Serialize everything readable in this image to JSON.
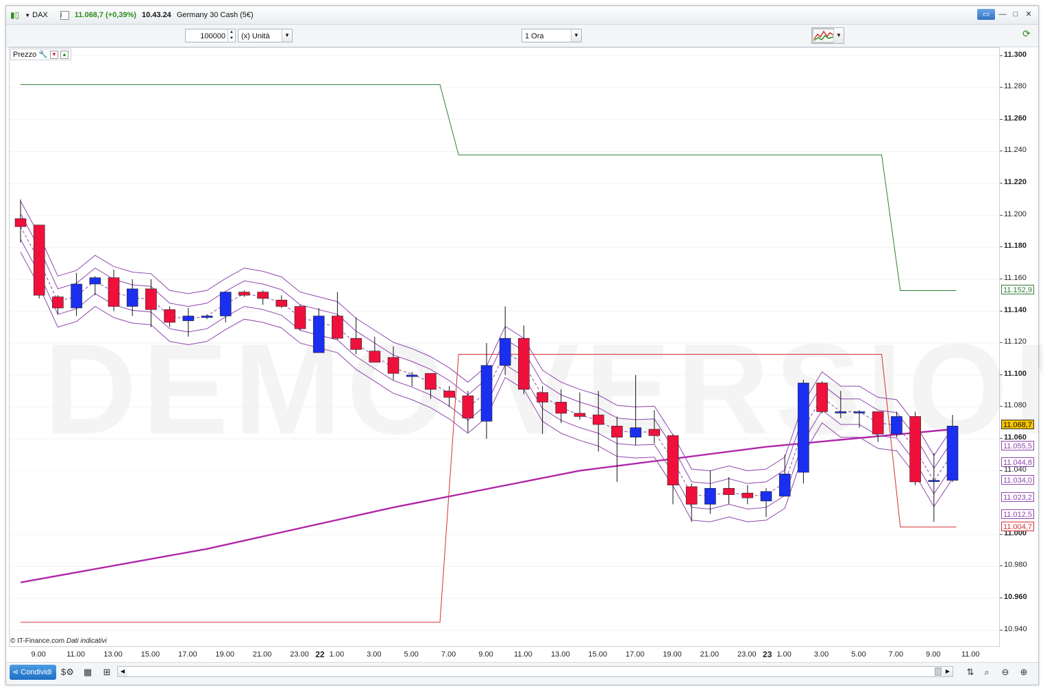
{
  "titlebar": {
    "symbol": "DAX",
    "info_icon": "i",
    "price_change": "11.068,7 (+0,39%)",
    "time": "10.43.24",
    "instrument": "Germany 30 Cash (5€)",
    "window_buttons": [
      "▭",
      "—",
      "□",
      "✕"
    ]
  },
  "toolbar": {
    "quantity": "100000",
    "unit": "(x) Unità",
    "timeframe": "1 Ora"
  },
  "chart": {
    "panel_label": "Prezzo",
    "watermark": "DEMO VERSION",
    "source_note": "© IT-Finance.com",
    "source_note_italic": "Dati indicativi",
    "price_ticks": [
      "11.300",
      "11.280",
      "11.260",
      "11.240",
      "11.220",
      "11.200",
      "11.180",
      "11.160",
      "11.140",
      "11.120",
      "11.100",
      "11.080",
      "11.060",
      "11.040",
      "11.000",
      "10.980",
      "10.960",
      "10.940"
    ],
    "price_tags": [
      {
        "label": "11.152,9",
        "kind": "green"
      },
      {
        "label": "11.068,7",
        "kind": "current"
      },
      {
        "label": "11.055,5",
        "kind": "purple"
      },
      {
        "label": "11.044,8",
        "kind": "purple"
      },
      {
        "label": "11.034,0",
        "kind": "purple"
      },
      {
        "label": "11.023,2",
        "kind": "purple"
      },
      {
        "label": "11.012,5",
        "kind": "purple"
      },
      {
        "label": "11.004,7",
        "kind": "red"
      }
    ],
    "time_labels": [
      {
        "t": "9.00",
        "day": false
      },
      {
        "t": "11.00",
        "day": false
      },
      {
        "t": "13.00",
        "day": false
      },
      {
        "t": "15.00",
        "day": false
      },
      {
        "t": "17.00",
        "day": false
      },
      {
        "t": "19.00",
        "day": false
      },
      {
        "t": "21.00",
        "day": false
      },
      {
        "t": "23.00",
        "day": false
      },
      {
        "t": "22",
        "day": true
      },
      {
        "t": "1.00",
        "day": false
      },
      {
        "t": "3.00",
        "day": false
      },
      {
        "t": "5.00",
        "day": false
      },
      {
        "t": "7.00",
        "day": false
      },
      {
        "t": "9.00",
        "day": false
      },
      {
        "t": "11.00",
        "day": false
      },
      {
        "t": "13.00",
        "day": false
      },
      {
        "t": "15.00",
        "day": false
      },
      {
        "t": "17.00",
        "day": false
      },
      {
        "t": "19.00",
        "day": false
      },
      {
        "t": "21.00",
        "day": false
      },
      {
        "t": "23.00",
        "day": false
      },
      {
        "t": "23",
        "day": true
      },
      {
        "t": "1.00",
        "day": false
      },
      {
        "t": "3.00",
        "day": false
      },
      {
        "t": "5.00",
        "day": false
      },
      {
        "t": "7.00",
        "day": false
      },
      {
        "t": "9.00",
        "day": false
      },
      {
        "t": "11.00",
        "day": false
      }
    ],
    "colors": {
      "up": "#1a2ff0",
      "down": "#f0103c",
      "resistance": "#2e7d32",
      "support": "#d32f2f",
      "bands": "#8e44ad",
      "ma": "#b026a8",
      "current": "#f5c400"
    }
  },
  "chart_data": {
    "type": "candlestick",
    "candles": [
      {
        "o": 11198,
        "h": 11210,
        "l": 11183,
        "c": 11193
      },
      {
        "o": 11194,
        "h": 11194,
        "l": 11148,
        "c": 11150
      },
      {
        "o": 11149,
        "h": 11150,
        "l": 11138,
        "c": 11142
      },
      {
        "o": 11142,
        "h": 11164,
        "l": 11137,
        "c": 11157
      },
      {
        "o": 11157,
        "h": 11162,
        "l": 11150,
        "c": 11161
      },
      {
        "o": 11161,
        "h": 11166,
        "l": 11140,
        "c": 11143
      },
      {
        "o": 11143,
        "h": 11160,
        "l": 11137,
        "c": 11154
      },
      {
        "o": 11154,
        "h": 11160,
        "l": 11130,
        "c": 11141
      },
      {
        "o": 11141,
        "h": 11143,
        "l": 11130,
        "c": 11133
      },
      {
        "o": 11134,
        "h": 11142,
        "l": 11124,
        "c": 11137
      },
      {
        "o": 11136,
        "h": 11138,
        "l": 11135,
        "c": 11137
      },
      {
        "o": 11137,
        "h": 11152,
        "l": 11133,
        "c": 11152
      },
      {
        "o": 11152,
        "h": 11153,
        "l": 11149,
        "c": 11150
      },
      {
        "o": 11152,
        "h": 11153,
        "l": 11144,
        "c": 11148
      },
      {
        "o": 11147,
        "h": 11150,
        "l": 11142,
        "c": 11143
      },
      {
        "o": 11143,
        "h": 11144,
        "l": 11128,
        "c": 11129
      },
      {
        "o": 11114,
        "h": 11142,
        "l": 11114,
        "c": 11137
      },
      {
        "o": 11137,
        "h": 11152,
        "l": 11122,
        "c": 11123
      },
      {
        "o": 11123,
        "h": 11136,
        "l": 11113,
        "c": 11116
      },
      {
        "o": 11115,
        "h": 11124,
        "l": 11108,
        "c": 11108
      },
      {
        "o": 11111,
        "h": 11118,
        "l": 11097,
        "c": 11101
      },
      {
        "o": 11099,
        "h": 11102,
        "l": 11093,
        "c": 11100
      },
      {
        "o": 11101,
        "h": 11101,
        "l": 11085,
        "c": 11091
      },
      {
        "o": 11090,
        "h": 11093,
        "l": 11080,
        "c": 11086
      },
      {
        "o": 11087,
        "h": 11090,
        "l": 11064,
        "c": 11073
      },
      {
        "o": 11071,
        "h": 11120,
        "l": 11060,
        "c": 11106
      },
      {
        "o": 11106,
        "h": 11143,
        "l": 11100,
        "c": 11123
      },
      {
        "o": 11123,
        "h": 11131,
        "l": 11088,
        "c": 11091
      },
      {
        "o": 11089,
        "h": 11093,
        "l": 11063,
        "c": 11083
      },
      {
        "o": 11083,
        "h": 11091,
        "l": 11070,
        "c": 11076
      },
      {
        "o": 11076,
        "h": 11089,
        "l": 11072,
        "c": 11074
      },
      {
        "o": 11075,
        "h": 11090,
        "l": 11052,
        "c": 11069
      },
      {
        "o": 11068,
        "h": 11074,
        "l": 11033,
        "c": 11061
      },
      {
        "o": 11061,
        "h": 11100,
        "l": 11056,
        "c": 11067
      },
      {
        "o": 11066,
        "h": 11078,
        "l": 11057,
        "c": 11062
      },
      {
        "o": 11062,
        "h": 11063,
        "l": 11019,
        "c": 11031
      },
      {
        "o": 11030,
        "h": 11032,
        "l": 11008,
        "c": 11019
      },
      {
        "o": 11019,
        "h": 11040,
        "l": 11013,
        "c": 11029
      },
      {
        "o": 11029,
        "h": 11036,
        "l": 11019,
        "c": 11025
      },
      {
        "o": 11026,
        "h": 11031,
        "l": 11019,
        "c": 11023
      },
      {
        "o": 11021,
        "h": 11029,
        "l": 11011,
        "c": 11027
      },
      {
        "o": 11024,
        "h": 11050,
        "l": 11024,
        "c": 11038
      },
      {
        "o": 11039,
        "h": 11097,
        "l": 11032,
        "c": 11095
      },
      {
        "o": 11095,
        "h": 11096,
        "l": 11076,
        "c": 11077
      },
      {
        "o": 11077,
        "h": 11090,
        "l": 11073,
        "c": 11077
      },
      {
        "o": 11077,
        "h": 11078,
        "l": 11067,
        "c": 11077
      },
      {
        "o": 11077,
        "h": 11077,
        "l": 11058,
        "c": 11063
      },
      {
        "o": 11063,
        "h": 11077,
        "l": 11061,
        "c": 11074
      },
      {
        "o": 11074,
        "h": 11077,
        "l": 11031,
        "c": 11033
      },
      {
        "o": 11034,
        "h": 11051,
        "l": 11008,
        "c": 11034
      },
      {
        "o": 11034,
        "h": 11075,
        "l": 11033,
        "c": 11068
      }
    ],
    "resistance": [
      {
        "i": 0,
        "v": 11282
      },
      {
        "i": 22.5,
        "v": 11282
      },
      {
        "i": 23.5,
        "v": 11238
      },
      {
        "i": 46.2,
        "v": 11238
      },
      {
        "i": 47.2,
        "v": 11152.9
      },
      {
        "i": 50.2,
        "v": 11152.9
      }
    ],
    "support": [
      {
        "i": 0,
        "v": 10945
      },
      {
        "i": 22.5,
        "v": 10945
      },
      {
        "i": 23.5,
        "v": 11113
      },
      {
        "i": 46.2,
        "v": 11113
      },
      {
        "i": 47.2,
        "v": 11004.7
      },
      {
        "i": 50.2,
        "v": 11004.7
      }
    ],
    "moving_average": [
      {
        "i": 0,
        "v": 10970
      },
      {
        "i": 10,
        "v": 10991
      },
      {
        "i": 20,
        "v": 11017
      },
      {
        "i": 30,
        "v": 11040
      },
      {
        "i": 40,
        "v": 11055
      },
      {
        "i": 50,
        "v": 11066
      }
    ],
    "ylim": [
      10930,
      11305
    ]
  },
  "statusbar": {
    "share_label": "Condividi"
  }
}
